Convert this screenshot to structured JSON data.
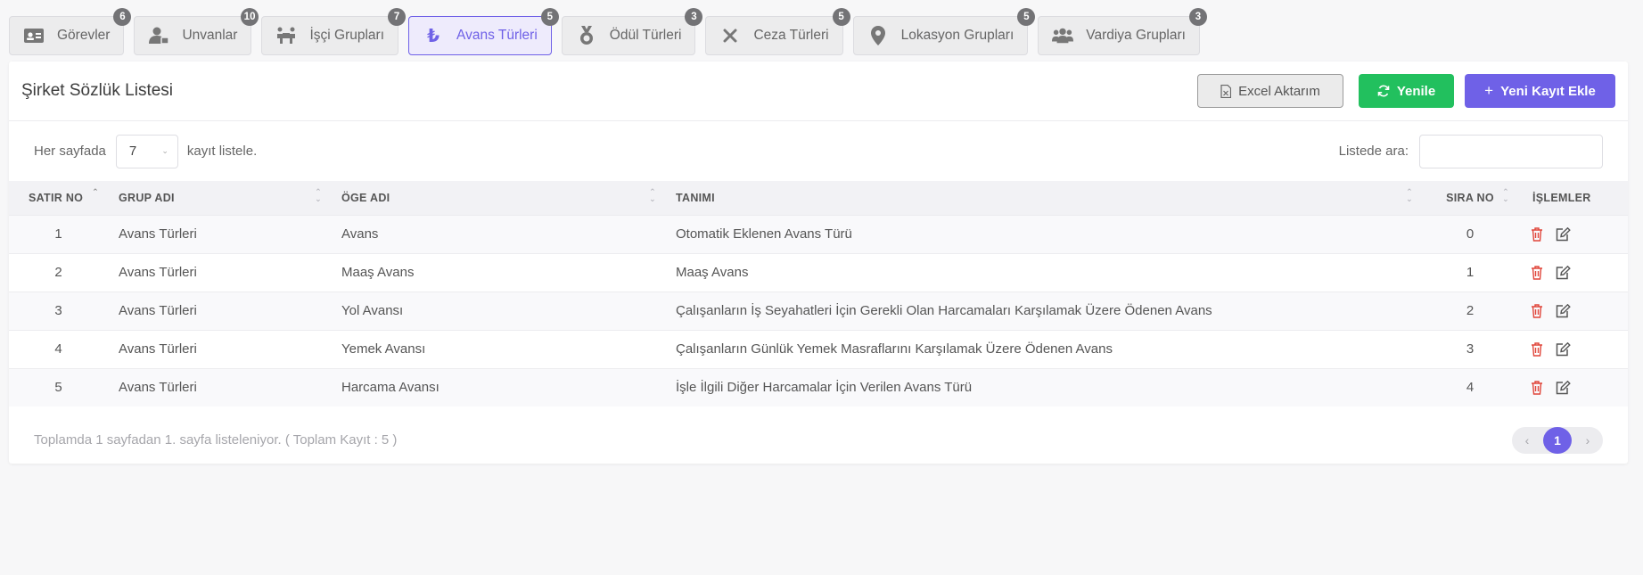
{
  "tabs": [
    {
      "label": "Görevler",
      "badge": "6",
      "icon": "id-card-icon"
    },
    {
      "label": "Unvanlar",
      "badge": "10",
      "icon": "user-tie-icon"
    },
    {
      "label": "İşçi Grupları",
      "badge": "7",
      "icon": "people-carry-icon"
    },
    {
      "label": "Avans Türleri",
      "badge": "5",
      "icon": "lira-icon"
    },
    {
      "label": "Ödül Türleri",
      "badge": "3",
      "icon": "medal-icon"
    },
    {
      "label": "Ceza Türleri",
      "badge": "5",
      "icon": "x-icon"
    },
    {
      "label": "Lokasyon Grupları",
      "badge": "5",
      "icon": "map-marker-icon"
    },
    {
      "label": "Vardiya Grupları",
      "badge": "3",
      "icon": "users-icon"
    }
  ],
  "active_tab": "Avans Türleri",
  "header": {
    "title": "Şirket Sözlük Listesi",
    "excel_label": "Excel Aktarım",
    "refresh_label": "Yenile",
    "new_label": "Yeni Kayıt Ekle"
  },
  "toolbar": {
    "per_page_prefix": "Her sayfada",
    "per_page_value": "7",
    "per_page_suffix": "kayıt listele.",
    "search_label": "Listede ara:",
    "search_value": ""
  },
  "table": {
    "columns": [
      "SATIR NO",
      "GRUP ADI",
      "ÖGE ADI",
      "TANIMI",
      "SIRA NO",
      "İŞLEMLER"
    ],
    "rows": [
      [
        "1",
        "Avans Türleri",
        "Avans",
        "Otomatik Eklenen Avans Türü",
        "0"
      ],
      [
        "2",
        "Avans Türleri",
        "Maaş Avans",
        "Maaş Avans",
        "1"
      ],
      [
        "3",
        "Avans Türleri",
        "Yol Avansı",
        "Çalışanların İş Seyahatleri İçin Gerekli Olan Harcamaları Karşılamak Üzere Ödenen Avans",
        "2"
      ],
      [
        "4",
        "Avans Türleri",
        "Yemek Avansı",
        "Çalışanların Günlük Yemek Masraflarını Karşılamak Üzere Ödenen Avans",
        "3"
      ],
      [
        "5",
        "Avans Türleri",
        "Harcama Avansı",
        "İşle İlgili Diğer Harcamalar İçin Verilen Avans Türü",
        "4"
      ]
    ]
  },
  "footer": {
    "summary": "Toplamda 1 sayfadan 1. sayfa listeleniyor. ( Toplam Kayıt : 5 )",
    "current_page": "1"
  },
  "colors": {
    "accent": "#6f61e7",
    "success": "#22c05e",
    "danger": "#e0453a",
    "badge": "#737376"
  }
}
